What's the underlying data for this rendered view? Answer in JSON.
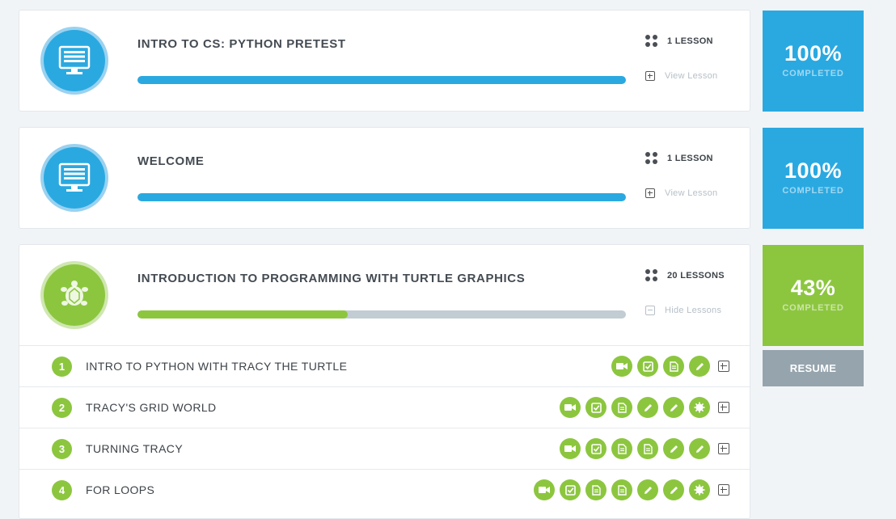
{
  "units": [
    {
      "title": "INTRO TO CS: PYTHON PRETEST",
      "lesson_count": "1 LESSON",
      "action_label": "View Lesson",
      "progress_fraction": 1.0,
      "percent_label": "100%",
      "completed_label": "COMPLETED",
      "color": "#2aa9e1",
      "icon": "monitor-icon"
    },
    {
      "title": "WELCOME",
      "lesson_count": "1 LESSON",
      "action_label": "View Lesson",
      "progress_fraction": 1.0,
      "percent_label": "100%",
      "completed_label": "COMPLETED",
      "color": "#2aa9e1",
      "icon": "monitor-icon"
    },
    {
      "title": "INTRODUCTION TO PROGRAMMING WITH TURTLE GRAPHICS",
      "lesson_count": "20 LESSONS",
      "action_label": "Hide Lessons",
      "progress_fraction": 0.43,
      "percent_label": "43%",
      "completed_label": "COMPLETED",
      "color": "#8cc63f",
      "icon": "turtle-icon",
      "resume_label": "RESUME"
    }
  ],
  "lessons": [
    {
      "number": "1",
      "title": "INTRO TO PYTHON WITH TRACY THE TURTLE",
      "activities": [
        "video-icon",
        "quiz-check-icon",
        "document-icon",
        "pencil-icon"
      ]
    },
    {
      "number": "2",
      "title": "TRACY'S GRID WORLD",
      "activities": [
        "video-icon",
        "quiz-check-icon",
        "document-icon",
        "pencil-icon",
        "pencil-icon",
        "badge-icon"
      ]
    },
    {
      "number": "3",
      "title": "TURNING TRACY",
      "activities": [
        "video-icon",
        "quiz-check-icon",
        "document-icon",
        "document-icon",
        "pencil-icon",
        "pencil-icon"
      ]
    },
    {
      "number": "4",
      "title": "FOR LOOPS",
      "activities": [
        "video-icon",
        "quiz-check-icon",
        "document-icon",
        "document-icon",
        "pencil-icon",
        "pencil-icon",
        "badge-icon"
      ]
    }
  ]
}
